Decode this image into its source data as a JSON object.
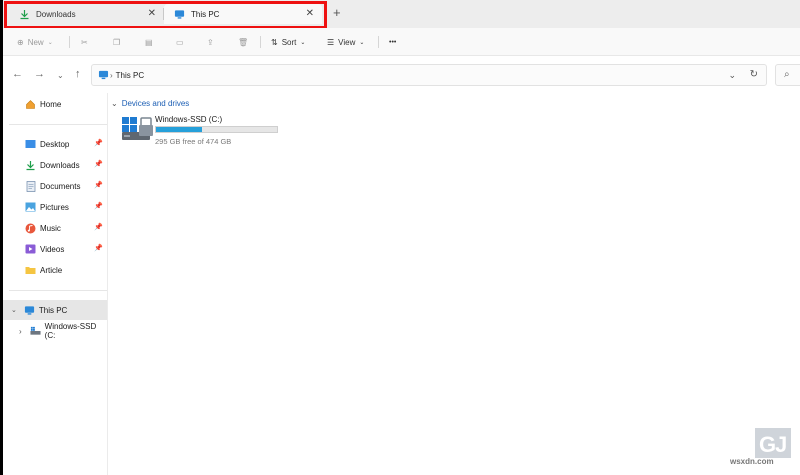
{
  "tabs": [
    {
      "label": "Downloads",
      "icon": "download-icon"
    },
    {
      "label": "This PC",
      "icon": "monitor-icon"
    }
  ],
  "toolbar": {
    "new_label": "New",
    "sort_label": "Sort",
    "view_label": "View",
    "more_label": "•••"
  },
  "address": {
    "path": "This PC"
  },
  "sidebar": {
    "home": "Home",
    "quick": [
      {
        "label": "Desktop",
        "icon": "desktop-icon"
      },
      {
        "label": "Downloads",
        "icon": "download-icon"
      },
      {
        "label": "Documents",
        "icon": "documents-icon"
      },
      {
        "label": "Pictures",
        "icon": "pictures-icon"
      },
      {
        "label": "Music",
        "icon": "music-icon"
      },
      {
        "label": "Videos",
        "icon": "videos-icon"
      },
      {
        "label": "Article",
        "icon": "folder-icon"
      }
    ],
    "this_pc": "This PC",
    "drive_child": "Windows-SSD (C:"
  },
  "main": {
    "section": "Devices and drives",
    "drive": {
      "name": "Windows-SSD (C:)",
      "free_text": "295 GB free of 474 GB",
      "used_fraction": 0.378
    }
  },
  "watermark": {
    "text": "wsxdn.com"
  },
  "colors": {
    "highlight": "#ee1111",
    "accent": "#26a0da",
    "link": "#1d5fb4"
  }
}
